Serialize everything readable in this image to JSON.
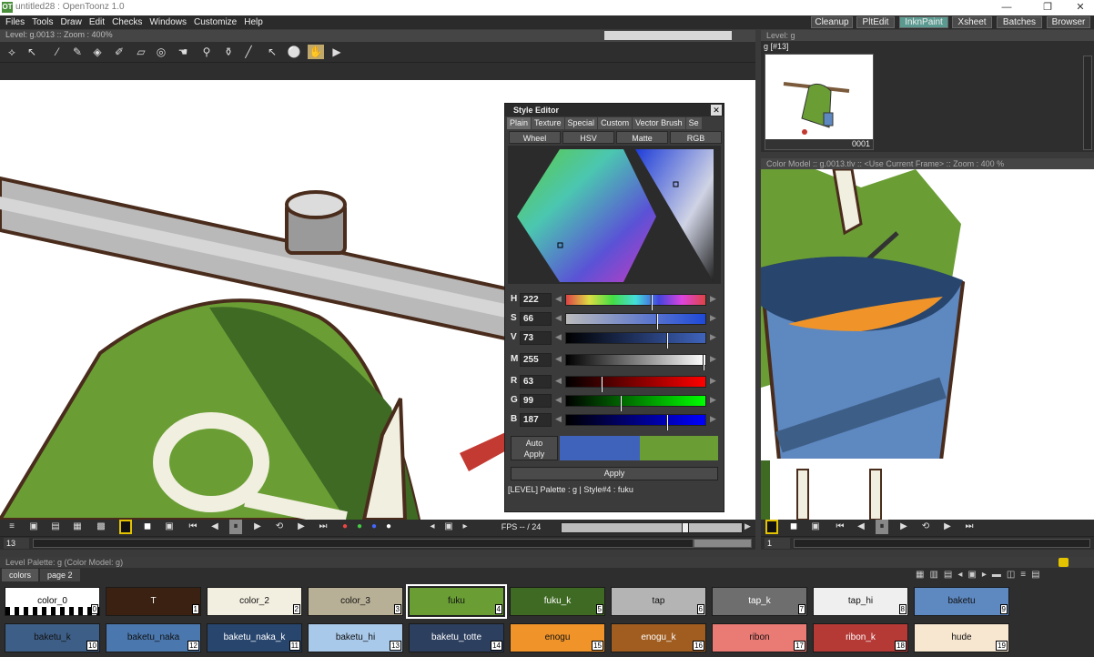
{
  "window": {
    "title": "untitled28 : OpenToonz 1.0",
    "logo": "OT",
    "min": "—",
    "max": "❐",
    "close": "✕"
  },
  "menu": [
    "Files",
    "Tools",
    "Draw",
    "Edit",
    "Checks",
    "Windows",
    "Customize",
    "Help"
  ],
  "rooms": [
    {
      "label": "Cleanup",
      "active": false
    },
    {
      "label": "PltEdit",
      "active": false
    },
    {
      "label": "InknPaint",
      "active": true
    },
    {
      "label": "Xsheet",
      "active": false
    },
    {
      "label": "Batches",
      "active": false
    },
    {
      "label": "Browser",
      "active": false
    }
  ],
  "viewer": {
    "info": "Level: g.0013  ::  Zoom : 400%",
    "frame": "13",
    "fps_label": "FPS -- / 24"
  },
  "style_editor": {
    "title": "Style Editor",
    "tabs": [
      "Plain",
      "Texture",
      "Special",
      "Custom",
      "Vector Brush",
      "Se"
    ],
    "modes": [
      "Wheel",
      "HSV",
      "Matte",
      "RGB"
    ],
    "channels": [
      {
        "label": "H",
        "value": "222",
        "pos": 0.62
      },
      {
        "label": "S",
        "value": "66",
        "pos": 0.66
      },
      {
        "label": "V",
        "value": "73",
        "pos": 0.73
      },
      {
        "label": "M",
        "value": "255",
        "pos": 1.0
      },
      {
        "label": "R",
        "value": "63",
        "pos": 0.25
      },
      {
        "label": "G",
        "value": "99",
        "pos": 0.39
      },
      {
        "label": "B",
        "value": "187",
        "pos": 0.73
      }
    ],
    "auto_apply": "Auto\nApply",
    "apply": "Apply",
    "status": "[LEVEL]  Palette : g | Style#4 : fuku",
    "current_color": "#3f63bb",
    "previous_color": "#6a9e35"
  },
  "level_strip": {
    "header": "Level: g",
    "cell_label": "g  [#13]",
    "frame_num": "0001"
  },
  "color_model": {
    "header": "Color Model :: g.0013.tlv  ::  <Use Current Frame>  ::  Zoom : 400 %",
    "frame": "1"
  },
  "palette": {
    "header": "Level Palette: g    (Color Model: g)",
    "pages": [
      "colors",
      "page 2"
    ],
    "chips": [
      {
        "name": "color_0",
        "idx": "0",
        "color": "#ffffff",
        "text": "#000"
      },
      {
        "name": "T",
        "idx": "1",
        "color": "#3a2112",
        "text": "#fff"
      },
      {
        "name": "color_2",
        "idx": "2",
        "color": "#f3efe0",
        "text": "#111"
      },
      {
        "name": "color_3",
        "idx": "3",
        "color": "#b8b096",
        "text": "#111"
      },
      {
        "name": "fuku",
        "idx": "4",
        "color": "#6a9e35",
        "text": "#111"
      },
      {
        "name": "fuku_k",
        "idx": "5",
        "color": "#3f6a24",
        "text": "#fff"
      },
      {
        "name": "tap",
        "idx": "6",
        "color": "#b4b4b4",
        "text": "#111"
      },
      {
        "name": "tap_k",
        "idx": "7",
        "color": "#6e6e6e",
        "text": "#fff"
      },
      {
        "name": "tap_hi",
        "idx": "8",
        "color": "#efefef",
        "text": "#111"
      },
      {
        "name": "baketu",
        "idx": "9",
        "color": "#5e88c0",
        "text": "#111"
      },
      {
        "name": "baketu_k",
        "idx": "10",
        "color": "#3d5e86",
        "text": "#111"
      },
      {
        "name": "baketu_naka",
        "idx": "12",
        "color": "#4a77ad",
        "text": "#111"
      },
      {
        "name": "baketu_naka_k",
        "idx": "11",
        "color": "#27456d",
        "text": "#fff"
      },
      {
        "name": "baketu_hi",
        "idx": "13",
        "color": "#a9c9ea",
        "text": "#111"
      },
      {
        "name": "baketu_totte",
        "idx": "14",
        "color": "#2c3f5f",
        "text": "#fff"
      },
      {
        "name": "enogu",
        "idx": "15",
        "color": "#f0942a",
        "text": "#111"
      },
      {
        "name": "enogu_k",
        "idx": "16",
        "color": "#a05d1f",
        "text": "#fff"
      },
      {
        "name": "ribon",
        "idx": "17",
        "color": "#ea7a74",
        "text": "#111"
      },
      {
        "name": "ribon_k",
        "idx": "18",
        "color": "#b53a36",
        "text": "#fff"
      },
      {
        "name": "hude",
        "idx": "19",
        "color": "#f7e6d0",
        "text": "#111"
      }
    ]
  }
}
